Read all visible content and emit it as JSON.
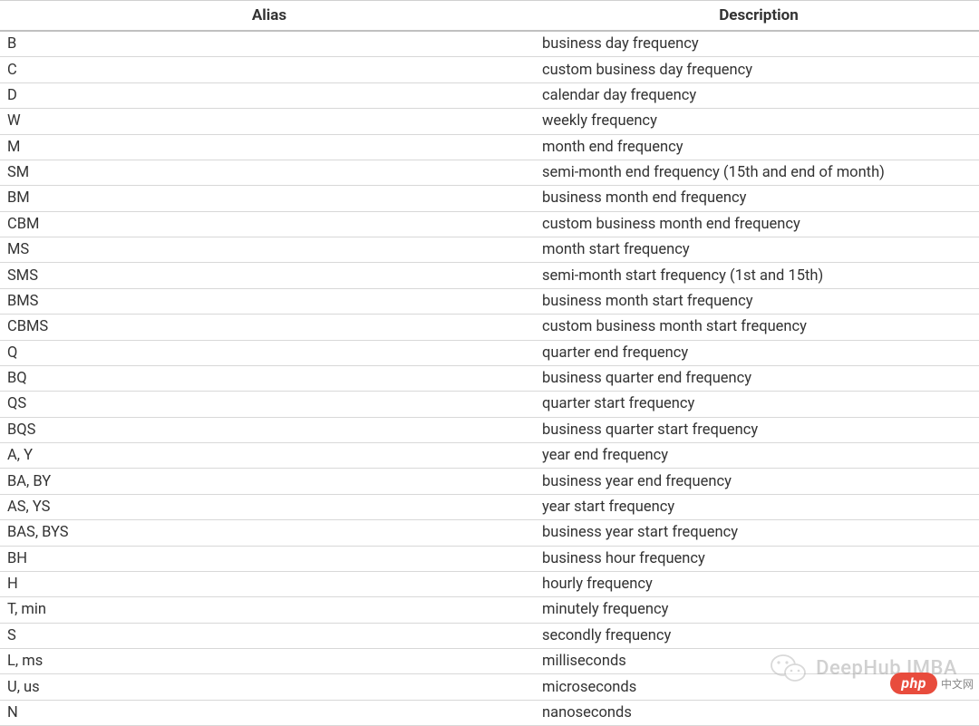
{
  "table": {
    "headers": {
      "alias": "Alias",
      "description": "Description"
    },
    "rows": [
      {
        "alias": "B",
        "description": "business day frequency"
      },
      {
        "alias": "C",
        "description": "custom business day frequency"
      },
      {
        "alias": "D",
        "description": "calendar day frequency"
      },
      {
        "alias": "W",
        "description": "weekly frequency"
      },
      {
        "alias": "M",
        "description": "month end frequency"
      },
      {
        "alias": "SM",
        "description": "semi-month end frequency (15th and end of month)"
      },
      {
        "alias": "BM",
        "description": "business month end frequency"
      },
      {
        "alias": "CBM",
        "description": "custom business month end frequency"
      },
      {
        "alias": "MS",
        "description": "month start frequency"
      },
      {
        "alias": "SMS",
        "description": "semi-month start frequency (1st and 15th)"
      },
      {
        "alias": "BMS",
        "description": "business month start frequency"
      },
      {
        "alias": "CBMS",
        "description": "custom business month start frequency"
      },
      {
        "alias": "Q",
        "description": "quarter end frequency"
      },
      {
        "alias": "BQ",
        "description": "business quarter end frequency"
      },
      {
        "alias": "QS",
        "description": "quarter start frequency"
      },
      {
        "alias": "BQS",
        "description": "business quarter start frequency"
      },
      {
        "alias": "A, Y",
        "description": "year end frequency"
      },
      {
        "alias": "BA, BY",
        "description": "business year end frequency"
      },
      {
        "alias": "AS, YS",
        "description": "year start frequency"
      },
      {
        "alias": "BAS, BYS",
        "description": "business year start frequency"
      },
      {
        "alias": "BH",
        "description": "business hour frequency"
      },
      {
        "alias": "H",
        "description": "hourly frequency"
      },
      {
        "alias": "T, min",
        "description": "minutely frequency"
      },
      {
        "alias": "S",
        "description": "secondly frequency"
      },
      {
        "alias": "L, ms",
        "description": "milliseconds"
      },
      {
        "alias": "U, us",
        "description": "microseconds"
      },
      {
        "alias": "N",
        "description": "nanoseconds"
      }
    ]
  },
  "watermark": {
    "text": "DeepHub IMBA",
    "icon": "wechat-icon"
  },
  "badge": {
    "pill": "php",
    "suffix": "中文网"
  }
}
